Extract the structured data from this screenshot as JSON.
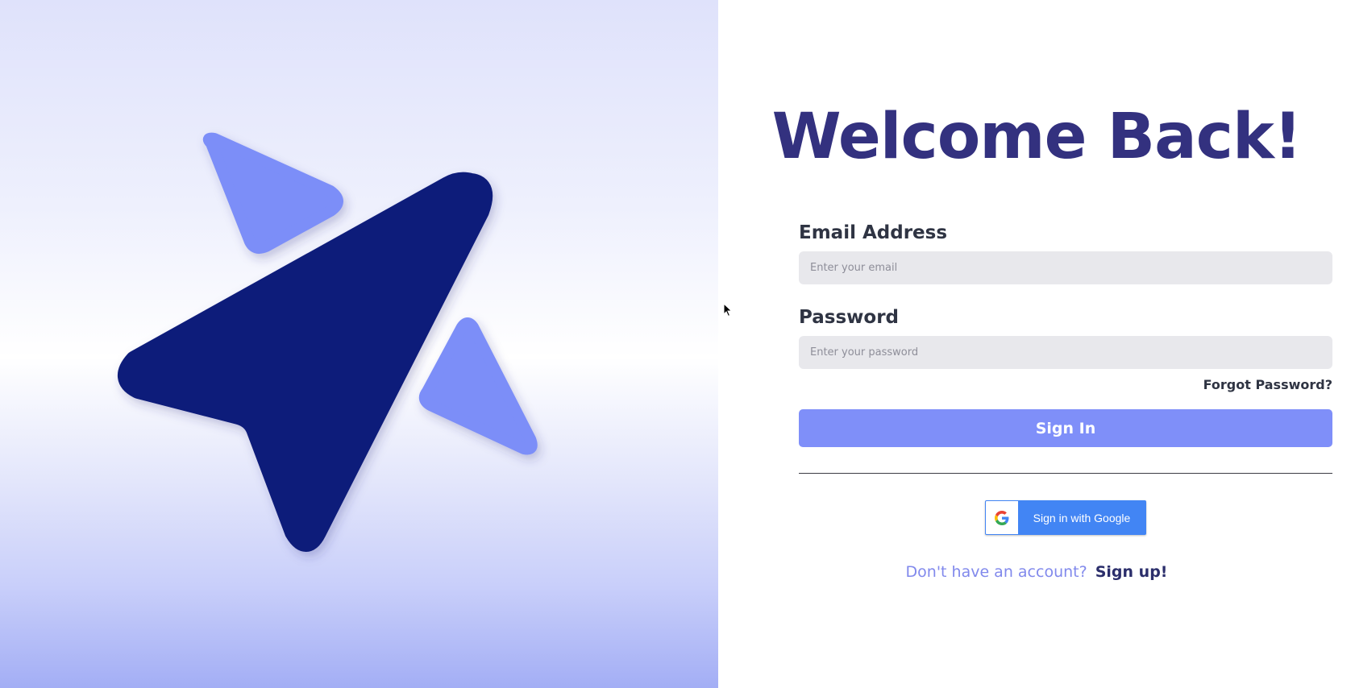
{
  "login": {
    "title": "Welcome Back!",
    "email_label": "Email Address",
    "email_placeholder": "Enter your email",
    "email_value": "",
    "password_label": "Password",
    "password_placeholder": "Enter your password",
    "password_value": "",
    "forgot_password": "Forgot Password?",
    "signin_label": "Sign In",
    "google_signin_label": "Sign in with Google",
    "signup_prompt": "Don't have an account?",
    "signup_link": "Sign up!"
  },
  "colors": {
    "title": "#33317f",
    "primary_button": "#7f8ff9",
    "google_blue": "#4285f4",
    "logo_dark": "#0d1b7a",
    "logo_light": "#7b8ef8",
    "signup_prompt": "#8189ec"
  },
  "icons": {
    "logo": "paper-plane-arrow-logo",
    "google": "google-g-icon",
    "cursor": "mouse-pointer-icon"
  }
}
